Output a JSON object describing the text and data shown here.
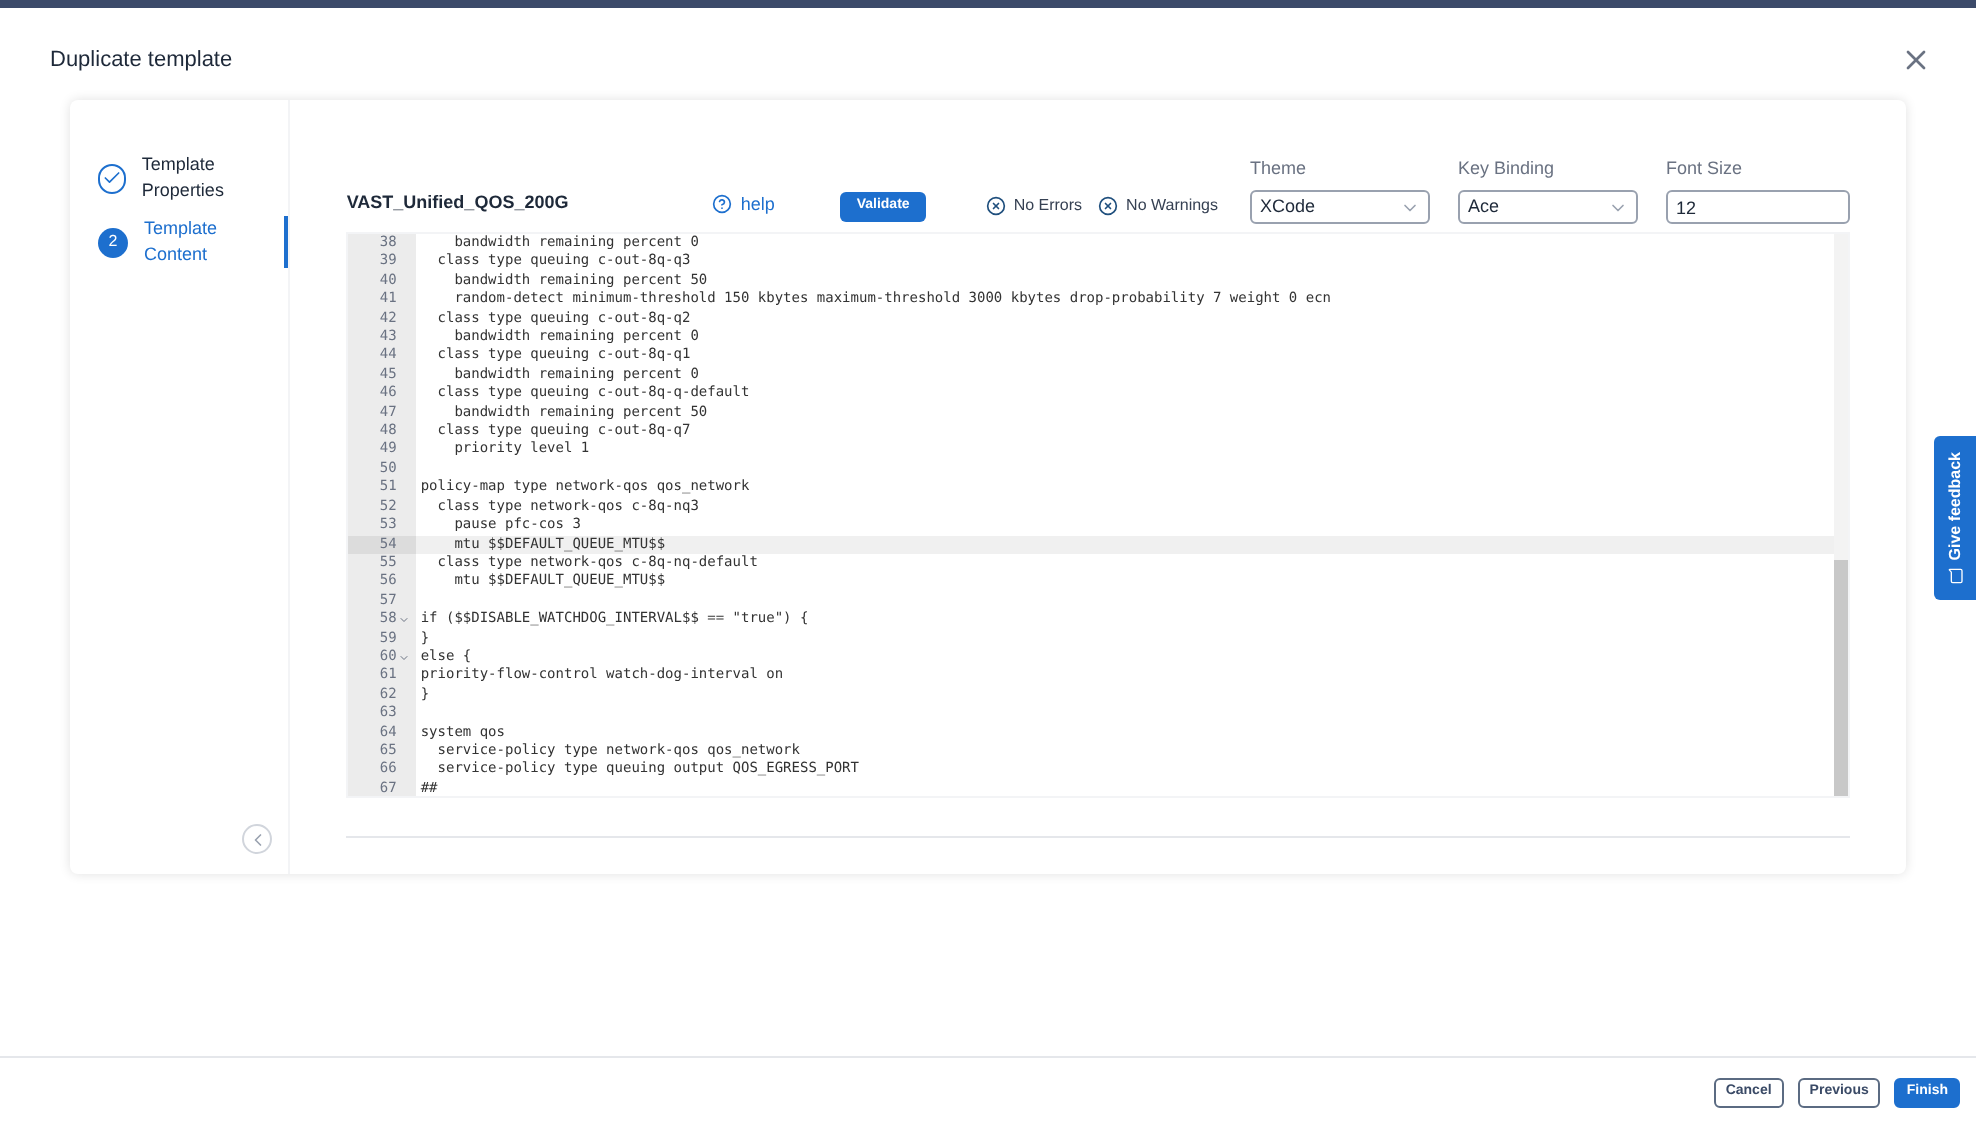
{
  "dialog": {
    "title": "Duplicate template"
  },
  "steps": [
    {
      "label": "Template Properties",
      "done": true,
      "selected": false
    },
    {
      "number": "2",
      "label": "Template Content",
      "done": false,
      "selected": true
    }
  ],
  "toolbar": {
    "template_name": "VAST_Unified_QOS_200G",
    "help": "help",
    "validate": "Validate",
    "errors": "No Errors",
    "warnings": "No Warnings",
    "theme": {
      "label": "Theme",
      "value": "XCode"
    },
    "key_binding": {
      "label": "Key Binding",
      "value": "Ace"
    },
    "font_size": {
      "label": "Font Size",
      "value": "12"
    }
  },
  "editor": {
    "lines": [
      {
        "n": "38",
        "text": "    bandwidth remaining percent 0",
        "fold": false,
        "active": false
      },
      {
        "n": "39",
        "text": "  class type queuing c-out-8q-q3",
        "fold": false,
        "active": false
      },
      {
        "n": "40",
        "text": "    bandwidth remaining percent 50",
        "fold": false,
        "active": false
      },
      {
        "n": "41",
        "text": "    random-detect minimum-threshold 150 kbytes maximum-threshold 3000 kbytes drop-probability 7 weight 0 ecn",
        "fold": false,
        "active": false
      },
      {
        "n": "42",
        "text": "  class type queuing c-out-8q-q2",
        "fold": false,
        "active": false
      },
      {
        "n": "43",
        "text": "    bandwidth remaining percent 0",
        "fold": false,
        "active": false
      },
      {
        "n": "44",
        "text": "  class type queuing c-out-8q-q1",
        "fold": false,
        "active": false
      },
      {
        "n": "45",
        "text": "    bandwidth remaining percent 0",
        "fold": false,
        "active": false
      },
      {
        "n": "46",
        "text": "  class type queuing c-out-8q-q-default",
        "fold": false,
        "active": false
      },
      {
        "n": "47",
        "text": "    bandwidth remaining percent 50",
        "fold": false,
        "active": false
      },
      {
        "n": "48",
        "text": "  class type queuing c-out-8q-q7",
        "fold": false,
        "active": false
      },
      {
        "n": "49",
        "text": "    priority level 1",
        "fold": false,
        "active": false
      },
      {
        "n": "50",
        "fold": false,
        "active": false
      },
      {
        "n": "51",
        "text": "policy-map type network-qos qos_network",
        "fold": false,
        "active": false
      },
      {
        "n": "52",
        "text": "  class type network-qos c-8q-nq3",
        "fold": false,
        "active": false
      },
      {
        "n": "53",
        "text": "    pause pfc-cos 3",
        "fold": false,
        "active": false
      },
      {
        "n": "54",
        "text": "    mtu $$DEFAULT_QUEUE_MTU$$",
        "fold": false,
        "active": true
      },
      {
        "n": "55",
        "text": "  class type network-qos c-8q-nq-default",
        "fold": false,
        "active": false
      },
      {
        "n": "56",
        "text": "    mtu $$DEFAULT_QUEUE_MTU$$",
        "fold": false,
        "active": false
      },
      {
        "n": "57",
        "fold": false,
        "active": false
      },
      {
        "n": "58",
        "text": "if ($$DISABLE_WATCHDOG_INTERVAL$$ == \"true\") {",
        "fold": true,
        "active": false
      },
      {
        "n": "59",
        "text": "}",
        "fold": false,
        "active": false
      },
      {
        "n": "60",
        "text": "else {",
        "fold": true,
        "active": false
      },
      {
        "n": "61",
        "text": "priority-flow-control watch-dog-interval on",
        "fold": false,
        "active": false
      },
      {
        "n": "62",
        "text": "}",
        "fold": false,
        "active": false
      },
      {
        "n": "63",
        "fold": false,
        "active": false
      },
      {
        "n": "64",
        "text": "system qos",
        "fold": false,
        "active": false
      },
      {
        "n": "65",
        "text": "  service-policy type network-qos qos_network",
        "fold": false,
        "active": false
      },
      {
        "n": "66",
        "text": "  service-policy type queuing output QOS_EGRESS_PORT",
        "fold": false,
        "active": false
      },
      {
        "n": "67",
        "text": "##",
        "fold": false,
        "active": false
      }
    ]
  },
  "feedback": "Give feedback",
  "buttons": [
    {
      "label": "Cancel",
      "primary": false
    },
    {
      "label": "Previous",
      "primary": false
    },
    {
      "label": "Finish",
      "primary": true
    }
  ]
}
